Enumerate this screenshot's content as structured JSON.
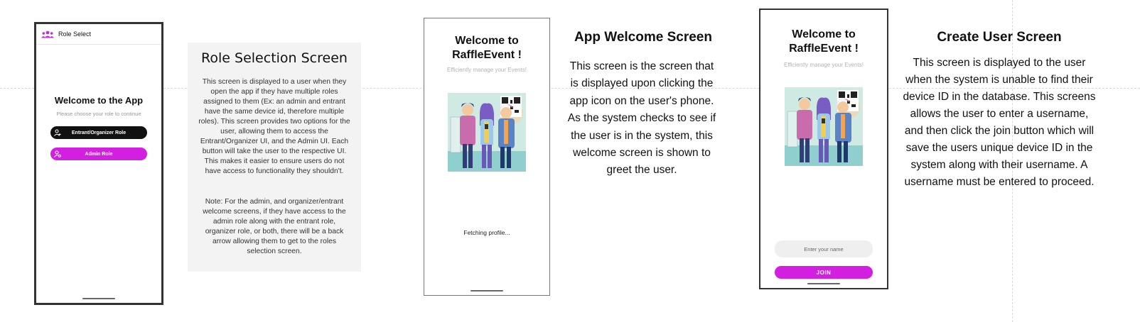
{
  "role_select_screen": {
    "appbar_title": "Role Select",
    "welcome": "Welcome to the App",
    "subtitle": "Please choose your role to continue",
    "entrant_button": "Entrant/Organizer Role",
    "admin_button": "Admin Role"
  },
  "role_panel": {
    "title": "Role Selection Screen",
    "paragraph1": "This screen is displayed to a user when they open the app if they have multiple roles assigned to them (Ex: an admin and entrant have the same device id, therefore multiple roles). This screen provides two options for the user, allowing them to access the Entrant/Organizer UI, and the Admin UI. Each button will take the user to the respective UI. This makes it easier to ensure users do not have access to functionality they shouldn't.",
    "paragraph2": "Note: For the admin, and organizer/entrant welcome screens, if they have access to the admin role along with the entrant role, organizer role, or both, there will be a back arrow allowing them to get to the roles selection screen."
  },
  "app_welcome_screen": {
    "title_line1": "Welcome to",
    "title_line2": "RaffleEvent !",
    "subtitle": "Efficiently manage your Events!",
    "status": "Fetching profile..."
  },
  "app_welcome_panel": {
    "title": "App Welcome Screen",
    "description": "This screen is the screen that is displayed upon clicking the app icon on the user's phone. As the system checks to see if the user is in the system, this welcome screen is shown to greet the user."
  },
  "create_user_screen": {
    "title_line1": "Welcome to",
    "title_line2": "RaffleEvent !",
    "subtitle": "Efficiently manage your Events!",
    "name_placeholder": "Enter your name",
    "join_button": "JOIN"
  },
  "create_user_panel": {
    "title": "Create User Screen",
    "description": "This screen is displayed to the user when the system is unable to find their device ID in the database. This screens allows the user to enter a username, and then click the join button which will save the users unique device ID in the system along with their username. A username must be entered to proceed."
  },
  "colors": {
    "accent": "#d21fe0",
    "dark_button": "#111111",
    "panel_bg": "#f3f3f3"
  },
  "icons": {
    "appbar": "group-icon",
    "entrant": "person-icon",
    "admin": "admin-gear-icon"
  }
}
